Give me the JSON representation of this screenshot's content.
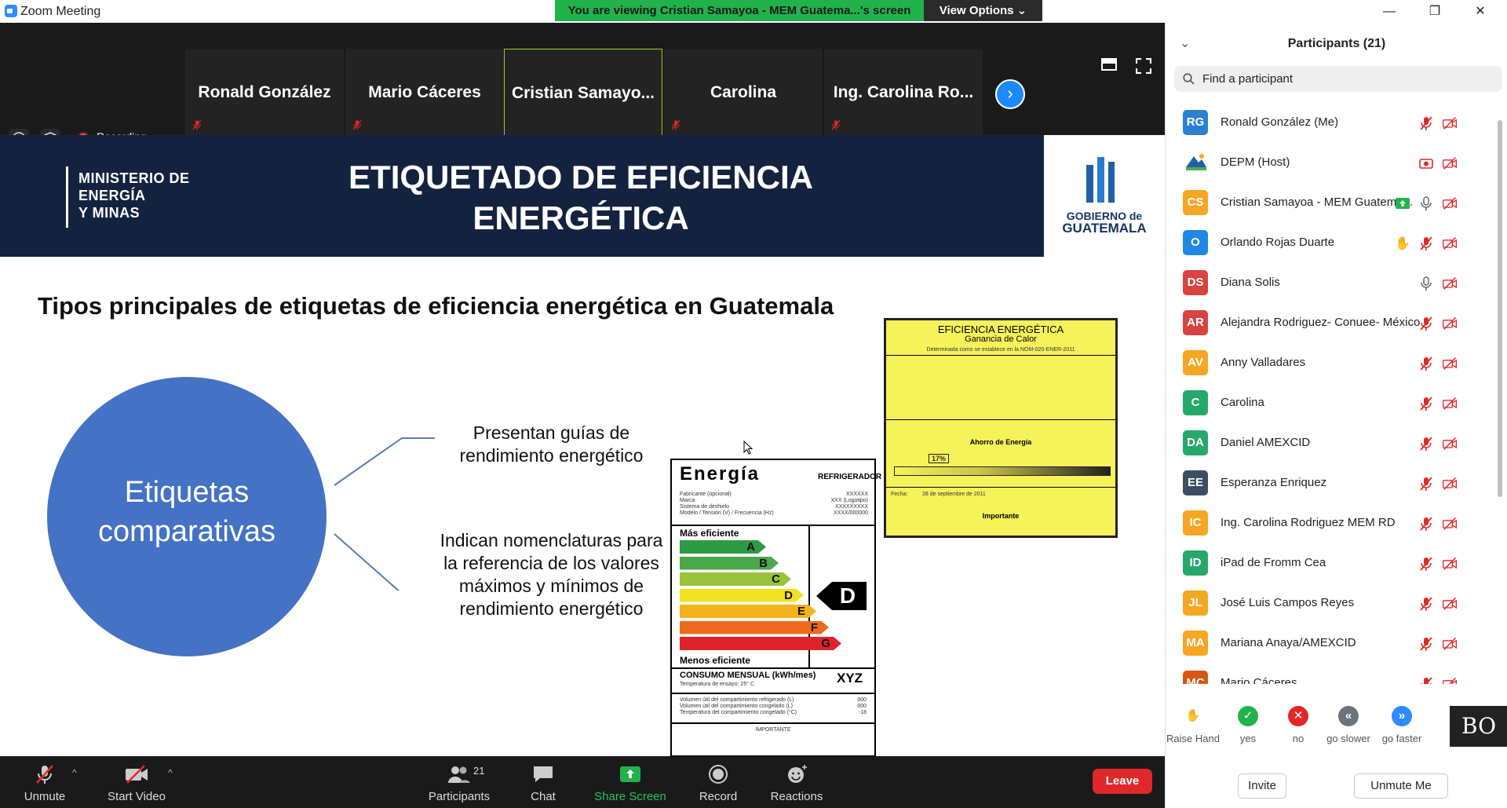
{
  "window": {
    "title": "Zoom Meeting",
    "minimize": "—",
    "restore": "❐",
    "close": "✕"
  },
  "share_banner": {
    "text": "You are viewing Cristian Samayoa - MEM Guatema...'s screen",
    "view_options": "View Options ⌄"
  },
  "video_tiles": [
    {
      "name": "Ronald González",
      "muted": true,
      "active": false
    },
    {
      "name": "Mario Cáceres",
      "muted": true,
      "active": false
    },
    {
      "name": "Cristian  Samayo...",
      "muted": false,
      "active": true
    },
    {
      "name": "Carolina",
      "muted": true,
      "active": false
    },
    {
      "name": "Ing. Carolina Ro...",
      "muted": true,
      "active": false
    }
  ],
  "recording": {
    "label": "Recording"
  },
  "slide": {
    "ministry_lines": [
      "MINISTERIO DE",
      "ENERGÍA",
      "Y MINAS"
    ],
    "title_line1": "ETIQUETADO DE EFICIENCIA",
    "title_line2": "ENERGÉTICA",
    "gov_logo_line1": "GOBIERNO de",
    "gov_logo_line2": "GUATEMALA",
    "subtitle": "Tipos principales de etiquetas de eficiencia energética en Guatemala",
    "circle_line1": "Etiquetas",
    "circle_line2": "comparativas",
    "desc1": "Presentan guías de rendimiento energético",
    "desc2": "Indican nomenclaturas para la referencia de los valores máximos y mínimos de rendimiento energético",
    "energy_label": {
      "title": "Energía",
      "type": "REFRIGERADOR",
      "fields": [
        "Fabricante (opcional)",
        "Marca",
        "Sistema de deshielo",
        "Modelo / Tensión (V) / Frecuencia (Hz)"
      ],
      "field_values": [
        "XXXXXX",
        "XXX (Logotipo)",
        "XXXXXXXXX",
        "XXXX/000000"
      ],
      "best": "Más eficiente",
      "worst": "Menos eficiente",
      "grades": [
        "A",
        "B",
        "C",
        "D",
        "E",
        "F",
        "G"
      ],
      "grade_colors": [
        "#2e9a46",
        "#4aa84a",
        "#9bc23c",
        "#f1e21f",
        "#f5b21c",
        "#ec6b1e",
        "#e0232a"
      ],
      "rating": "D",
      "consumo": "CONSUMO MENSUAL (kWh/mes)",
      "consumo_note": "Temperatura de ensayo: 25° C",
      "consumo_value": "XYZ",
      "volumes": [
        "Volumen útil del compartimiento refrigerado (L)",
        "Volumen útil del compartimiento congelado (L)",
        "Temperatura del compartimiento congelado (°C)"
      ],
      "volume_values": [
        "000",
        "000",
        "-18"
      ],
      "importante": "IMPORTANTE"
    },
    "yellow_label": {
      "title": "EFICIENCIA ENERGÉTICA",
      "subtitle": "Ganancia de Calor",
      "norm": "Determinada como se establece en la NOM-020-ENER-2011",
      "saving_title": "Ahorro de Energía",
      "saving_value": "17%",
      "date_label": "Fecha:",
      "date_value": "28 de septiembre de 2011",
      "important": "Importante"
    }
  },
  "toolbar": {
    "unmute": "Unmute",
    "start_video": "Start Video",
    "participants": "Participants",
    "participants_count": "21",
    "chat": "Chat",
    "share_screen": "Share Screen",
    "record": "Record",
    "reactions": "Reactions",
    "leave": "Leave"
  },
  "panel": {
    "header": "Participants (21)",
    "search_placeholder": "Find a participant",
    "participants": [
      {
        "initials": "RG",
        "name": "Ronald González (Me)",
        "color": "#2d7fd3"
      },
      {
        "initials": "",
        "name": "DEPM (Host)",
        "color": "#ffffff"
      },
      {
        "initials": "CS",
        "name": "Cristian Samayoa - MEM Guatema...",
        "color": "#f5a623"
      },
      {
        "initials": "O",
        "name": "Orlando Rojas Duarte",
        "color": "#1e88e5"
      },
      {
        "initials": "DS",
        "name": "Diana Solis",
        "color": "#d9433f"
      },
      {
        "initials": "AR",
        "name": " Alejandra Rodriguez- Conuee- México",
        "color": "#d9433f"
      },
      {
        "initials": "AV",
        "name": "Anny Valladares",
        "color": "#f5a623"
      },
      {
        "initials": "C",
        "name": "Carolina",
        "color": "#27a86b"
      },
      {
        "initials": "DA",
        "name": "Daniel AMEXCID",
        "color": "#27a86b"
      },
      {
        "initials": "EE",
        "name": "Esperanza Enriquez",
        "color": "#3c4e63"
      },
      {
        "initials": "IC",
        "name": "Ing. Carolina Rodriguez MEM RD",
        "color": "#f5a623"
      },
      {
        "initials": "ID",
        "name": "iPad de Fromm Cea",
        "color": "#27a86b"
      },
      {
        "initials": "JL",
        "name": "José Luis Campos Reyes",
        "color": "#f5a623"
      },
      {
        "initials": "MA",
        "name": "Mariana Anaya/AMEXCID",
        "color": "#f5a623"
      },
      {
        "initials": "MC",
        "name": "Mario Cáceres",
        "color": "#d9540f"
      }
    ],
    "reactions": [
      {
        "label": "Raise Hand",
        "symbol": "✋",
        "color": "#2d8cff"
      },
      {
        "label": "yes",
        "symbol": "✓",
        "color": "#22b24c"
      },
      {
        "label": "no",
        "symbol": "✕",
        "color": "#e02828"
      },
      {
        "label": "go slower",
        "symbol": "«",
        "color": "#6b7280"
      },
      {
        "label": "go faster",
        "symbol": "»",
        "color": "#2d8cff"
      }
    ],
    "bo_logo": "BO",
    "invite": "Invite",
    "unmute_me": "Unmute Me"
  }
}
